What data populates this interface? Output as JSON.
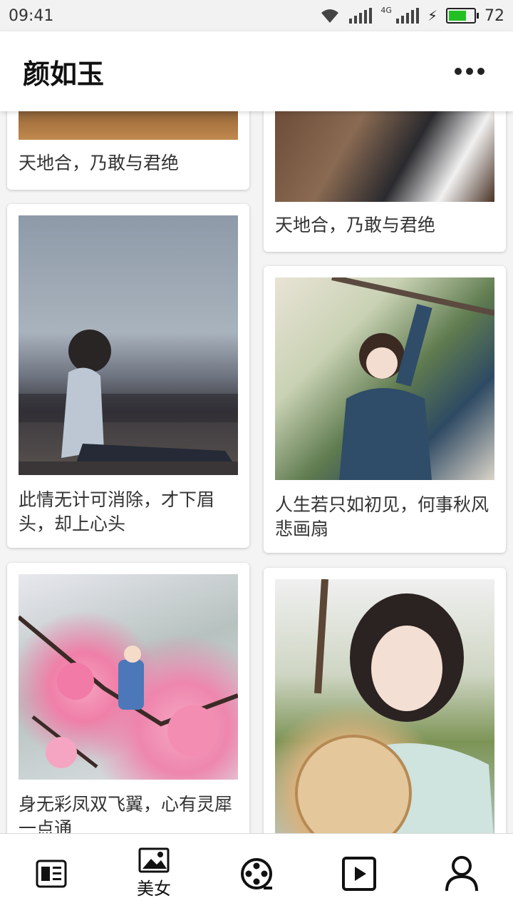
{
  "status_bar": {
    "time": "09:41",
    "network_label": "4G",
    "battery_level": "72",
    "battery_fraction": 0.72
  },
  "header": {
    "title": "颜如玉",
    "more_icon": "more-horizontal-icon"
  },
  "feed": {
    "left_column": [
      {
        "caption": "天地合，乃敢与君绝"
      },
      {
        "caption": "此情无计可消除，才下眉头，却上心头"
      },
      {
        "caption": "身无彩凤双飞翼，心有灵犀一点通"
      }
    ],
    "right_column": [
      {
        "caption": "天地合，乃敢与君绝"
      },
      {
        "caption": "人生若只如初见，何事秋风悲画扇"
      },
      {
        "caption": ""
      }
    ]
  },
  "tab_bar": {
    "tabs": [
      {
        "icon": "news-icon",
        "label": ""
      },
      {
        "icon": "picture-icon",
        "label": "美女"
      },
      {
        "icon": "film-reel-icon",
        "label": ""
      },
      {
        "icon": "play-icon",
        "label": ""
      },
      {
        "icon": "user-icon",
        "label": ""
      }
    ],
    "active_index": 1
  }
}
